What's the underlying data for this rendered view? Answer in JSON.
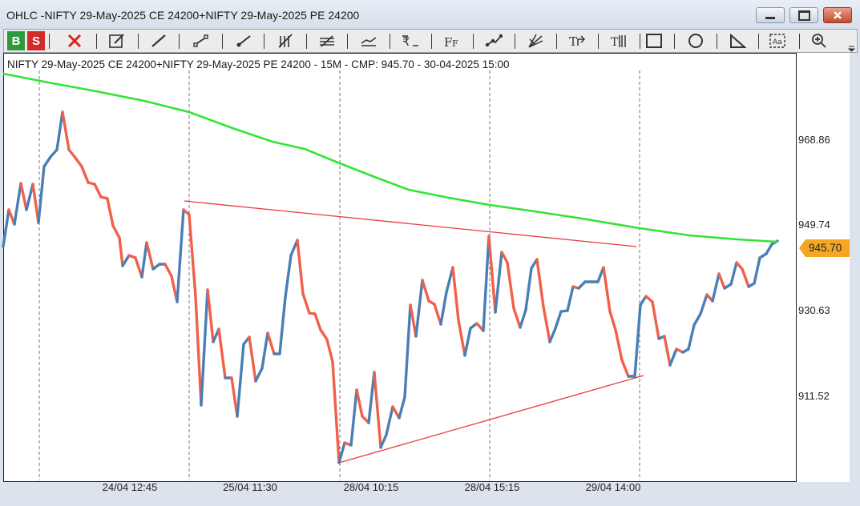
{
  "window": {
    "title": "OHLC -NIFTY 29-May-2025 CE 24200+NIFTY 29-May-2025 PE 24200"
  },
  "toolbar": {
    "buy_label": "B",
    "sell_label": "S",
    "tools": [
      "close-icon",
      "edit-icon",
      "line-icon",
      "ray-icon",
      "extended-line-icon",
      "andrews-pitchfork-icon",
      "fib-fan-icon",
      "parallel-channel-icon",
      "price-label-icon",
      "fib-retracement-icon",
      "trend-angle-icon",
      "gann-icon",
      "text-tool-icon",
      "fib-timezone-icon",
      "rectangle-icon",
      "ellipse-icon",
      "triangle-icon",
      "text-box-icon",
      "zoom-icon"
    ]
  },
  "chart": {
    "header": "NIFTY 29-May-2025 CE 24200+NIFTY 29-May-2025 PE 24200  - 15M -  CMP: 945.70 - 30-04-2025 15:00",
    "cmp_label": "945.70",
    "y_ticks": [
      "968.86",
      "949.74",
      "930.63",
      "911.52"
    ],
    "x_ticks": [
      "24/04 12:45",
      "25/04 11:30",
      "28/04 10:15",
      "28/04 15:15",
      "29/04 14:00"
    ],
    "colors": {
      "up": "#4a7fb5",
      "down": "#f0604a",
      "ma": "#33e533",
      "trend": "#e83a3a",
      "cmp": "#f5a623"
    }
  }
}
